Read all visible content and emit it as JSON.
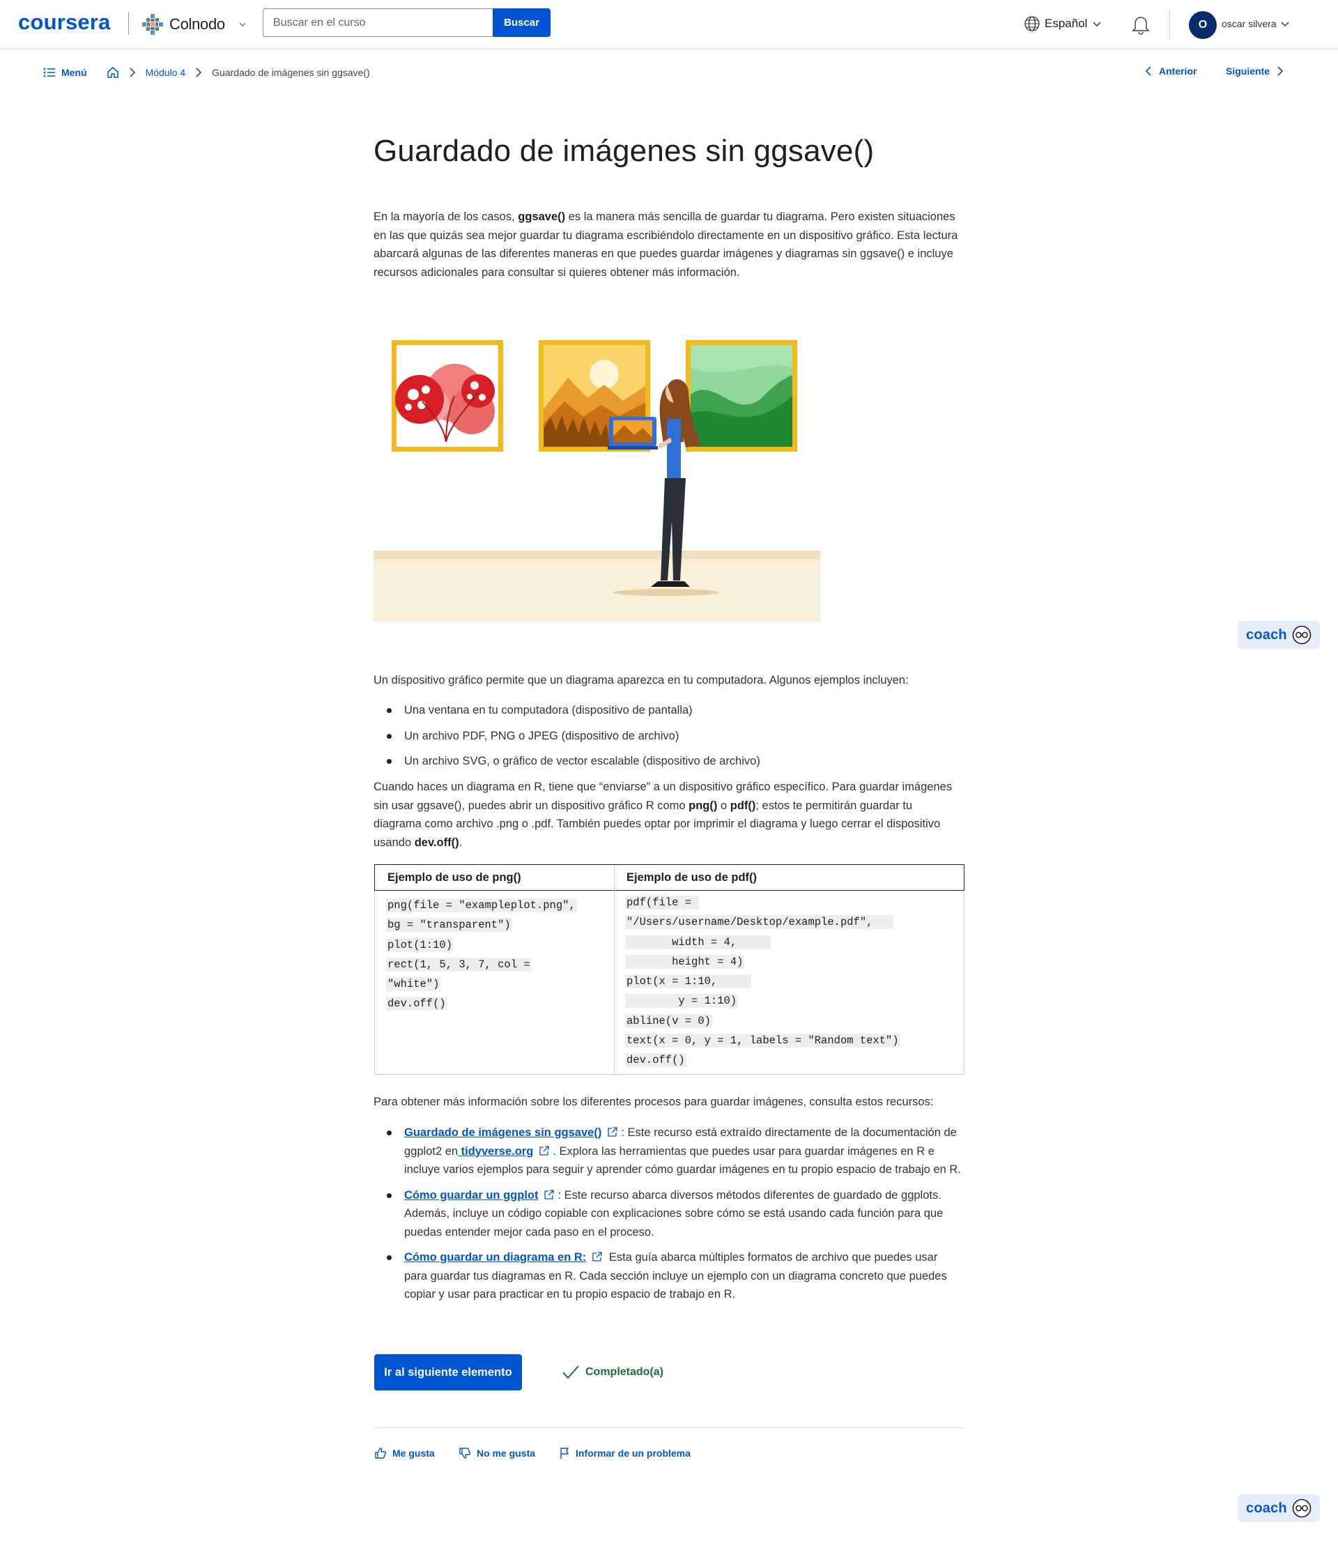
{
  "header": {
    "logo": "coursera",
    "partner": "Colnodo",
    "search_placeholder": "Buscar en el curso",
    "search_button": "Buscar",
    "language": "Español",
    "avatar_initial": "O",
    "username": "oscar silvera"
  },
  "breadcrumb": {
    "menu": "Menú",
    "module": "Módulo 4",
    "current": "Guardado de imágenes sin ggsave()",
    "prev": "Anterior",
    "next": "Siguiente"
  },
  "content": {
    "title": "Guardado de imágenes sin ggsave()",
    "intro_a": "En la mayoría de los casos, ",
    "intro_b": "ggsave()",
    "intro_c": " es la manera más sencilla de guardar tu diagrama. Pero existen situaciones en las que quizás sea mejor guardar tu diagrama escribiéndolo directamente en un dispositivo gráfico. Esta lectura abarcará algunas de las diferentes maneras en que puedes guardar imágenes y diagramas sin ggsave() e incluye recursos adicionales para consultar si quieres obtener más información.",
    "device_intro": "Un dispositivo gráfico permite que un diagrama aparezca en tu computadora. Algunos ejemplos incluyen:",
    "device_examples": [
      "Una ventana en tu computadora (dispositivo de pantalla)",
      "Un archivo PDF, PNG o JPEG (dispositivo de archivo)",
      "Un archivo SVG, o gráfico de vector escalable (dispositivo de archivo)"
    ],
    "p3_a": "Cuando haces un diagrama en R, tiene que “enviarse” a un dispositivo gráfico específico. Para guardar imágenes sin usar ggsave(), puedes abrir un dispositivo gráfico R como ",
    "p3_b": "png()",
    "p3_c": " o ",
    "p3_d": "pdf()",
    "p3_e": "; estos te permitirán guardar tu diagrama como archivo .png o .pdf. También puedes optar por imprimir el diagrama y luego cerrar el dispositivo usando ",
    "p3_f": "dev.off()",
    "p3_g": ".",
    "code_table": {
      "left_header": "Ejemplo de uso de png()",
      "right_header": "Ejemplo de uso de pdf()",
      "left_lines": [
        "png(file = \"exampleplot.png\",",
        "bg = \"transparent\")",
        "plot(1:10)",
        "rect(1, 5, 3, 7, col =",
        "\"white\")",
        "dev.off()"
      ],
      "right_lines": [
        "pdf(file = ",
        "\"/Users/username/Desktop/example.pdf\",   ",
        "       width = 4,     ",
        "       height = 4)",
        "plot(x = 1:10,     ",
        "        y = 1:10)",
        "abline(v = 0)",
        "text(x = 0, y = 1, labels = \"Random text\")",
        "dev.off()"
      ]
    },
    "resources_intro": "Para obtener más información sobre los diferentes procesos para guardar imágenes, consulta estos recursos:",
    "resources": [
      {
        "link": "Guardado de imágenes sin ggsave()",
        "text_a": ": Este recurso está extraído directamente de la documentación de ggplot2 en",
        "link2": " tidyverse.org",
        "text_b": ". Explora las herramientas que puedes usar para guardar imágenes en R e incluye varios ejemplos para seguir y aprender cómo guardar imágenes en tu propio espacio de trabajo en R."
      },
      {
        "link": "Cómo guardar un ggplot",
        "text_a": ": Este recurso abarca diversos métodos diferentes de guardado de ggplots. Además, incluye un código copiable con explicaciones sobre cómo se está usando cada función para que puedas entender mejor cada paso en el proceso."
      },
      {
        "link": "Cómo guardar un diagrama en R:",
        "text_a": " Esta guía abarca múltiples formatos de archivo que puedes usar para guardar tus diagramas en R. Cada sección incluye un ejemplo con un diagrama concreto que puedes copiar y usar para practicar en tu propio espacio de trabajo en R."
      }
    ]
  },
  "footer": {
    "next_button": "Ir al siguiente elemento",
    "completed": "Completado(a)",
    "like": "Me gusta",
    "dislike": "No me gusta",
    "report": "Informar de un problema"
  },
  "coach": {
    "label": "coach"
  },
  "colors": {
    "accent": "#0056d2",
    "success": "#1c6b3b",
    "avatar": "#0b2c6b"
  }
}
